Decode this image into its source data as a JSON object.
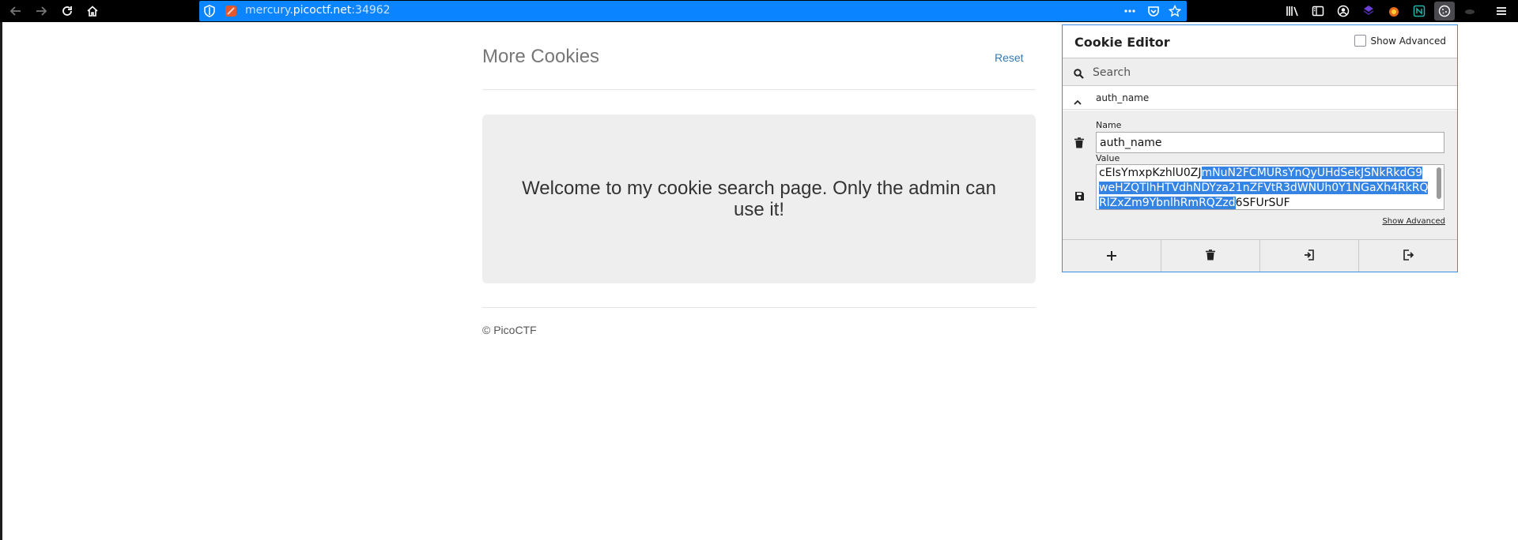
{
  "browser": {
    "url_host_prefix": "mercury.",
    "url_host_domain": "picoctf.net",
    "url_port": ":34962",
    "icons": [
      "back-icon",
      "forward-icon",
      "reload-icon",
      "home-icon",
      "shield-icon",
      "site-icon",
      "more-dots-icon",
      "pocket-icon",
      "bookmark-star-icon",
      "library-icon",
      "sidebar-icon",
      "account-icon",
      "extension-icon",
      "extension-icon",
      "extension-icon",
      "cookie-editor-icon",
      "extension-icon",
      "menu-icon"
    ]
  },
  "page": {
    "title": "More Cookies",
    "reset_label": "Reset",
    "jumbotron_text": "Welcome to my cookie search page. Only the admin can use it!",
    "footer": "© PicoCTF"
  },
  "cookie_editor": {
    "title": "Cookie Editor",
    "show_advanced_label": "Show Advanced",
    "search_placeholder": "Search",
    "cookie_name_header": "auth_name",
    "name_label": "Name",
    "name_value": "auth_name",
    "value_label": "Value",
    "value_unselected_start": "cEIsYmxpKzhlU0ZJ",
    "value_selected": "mNuN2FCMURsYnQyUHdSekJSNkRkdG9weHZQTlhHTVdhNDYza21nZFVtR3dWNUh0Y1NGaXh4RkRQRlZxZm9YbnlhRmRQZzd",
    "value_unselected_end": "6SFUrSUF",
    "show_advanced_link": "Show Advanced",
    "actions": [
      "add-icon",
      "delete-all-icon",
      "import-icon",
      "export-icon"
    ]
  }
}
